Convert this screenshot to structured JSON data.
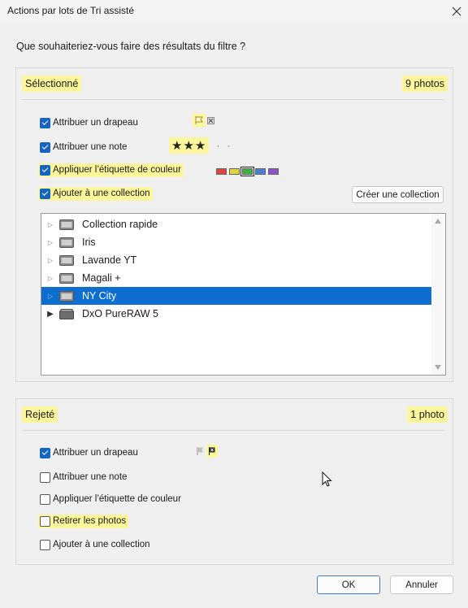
{
  "window": {
    "title": "Actions par lots de Tri assisté",
    "close_icon": "close-icon"
  },
  "question": "Que souhaiteriez-vous faire des résultats du filtre ?",
  "selected": {
    "name": "Sélectionné",
    "count": "9 photos",
    "options": [
      {
        "label": "Attribuer un drapeau",
        "checked": true
      },
      {
        "label": "Attribuer une note",
        "checked": true,
        "rating": 3
      },
      {
        "label": "Appliquer l’étiquette de couleur",
        "checked": true
      },
      {
        "label": "Ajouter à une collection",
        "checked": true
      }
    ],
    "stars": "★★★",
    "color_labels": [
      "#e04545",
      "#dcd441",
      "#3cb043",
      "#4a7fd4",
      "#9051c6"
    ],
    "selected_color": "#3cb043",
    "create_collection_label": "Créer une collection",
    "collections": [
      {
        "name": "Collection rapide",
        "selected": false
      },
      {
        "name": "Iris",
        "selected": false
      },
      {
        "name": "Lavande YT",
        "selected": false
      },
      {
        "name": "Magali +",
        "selected": false
      },
      {
        "name": "NY City",
        "selected": true
      },
      {
        "name": "DxO PureRAW 5",
        "selected": false
      }
    ]
  },
  "rejected": {
    "name": "Rejeté",
    "count": "1 photo",
    "options": [
      {
        "label": "Attribuer un drapeau",
        "checked": true
      },
      {
        "label": "Attribuer une note",
        "checked": false
      },
      {
        "label": "Appliquer l’étiquette de couleur",
        "checked": false
      },
      {
        "label": "Retirer les photos",
        "checked": false
      },
      {
        "label": "Ajouter à une collection",
        "checked": false
      }
    ]
  },
  "buttons": {
    "ok": "OK",
    "cancel": "Annuler"
  },
  "colors": {
    "highlight": "#fbf59b",
    "accent": "#0e6ecf",
    "checkbox": "#1565c0"
  }
}
